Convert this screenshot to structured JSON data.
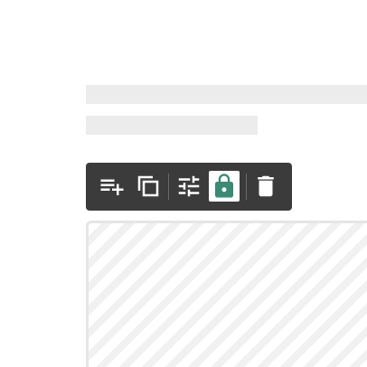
{
  "colors": {
    "toolbar_background": "#3b3b3b",
    "icon_color": "#ffffff",
    "lock_active_background": "#ffffff",
    "lock_icon_color": "#3a8a74",
    "skeleton": "#ececec",
    "placeholder_stripe": "#f1f1f1"
  },
  "toolbar": {
    "tools": [
      {
        "icon": "playlist-add-icon",
        "active": false
      },
      {
        "icon": "duplicate-icon",
        "active": false
      },
      {
        "icon": "tune-settings-icon",
        "active": false
      },
      {
        "icon": "lock-icon",
        "active": true
      },
      {
        "icon": "trash-icon",
        "active": false
      }
    ]
  }
}
